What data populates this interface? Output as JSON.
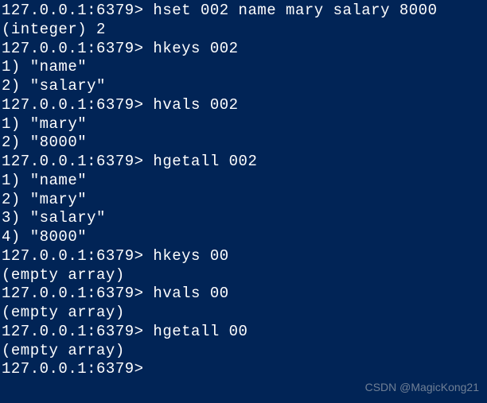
{
  "prompt": "127.0.0.1:6379> ",
  "lines": [
    "127.0.0.1:6379> hset 002 name mary salary 8000",
    "(integer) 2",
    "127.0.0.1:6379> hkeys 002",
    "1) \"name\"",
    "2) \"salary\"",
    "127.0.0.1:6379> hvals 002",
    "1) \"mary\"",
    "2) \"8000\"",
    "127.0.0.1:6379> hgetall 002",
    "1) \"name\"",
    "2) \"mary\"",
    "3) \"salary\"",
    "4) \"8000\"",
    "127.0.0.1:6379> hkeys 00",
    "(empty array)",
    "127.0.0.1:6379> hvals 00",
    "(empty array)",
    "127.0.0.1:6379> hgetall 00",
    "(empty array)",
    "127.0.0.1:6379>"
  ],
  "watermark": "CSDN @MagicKong21"
}
